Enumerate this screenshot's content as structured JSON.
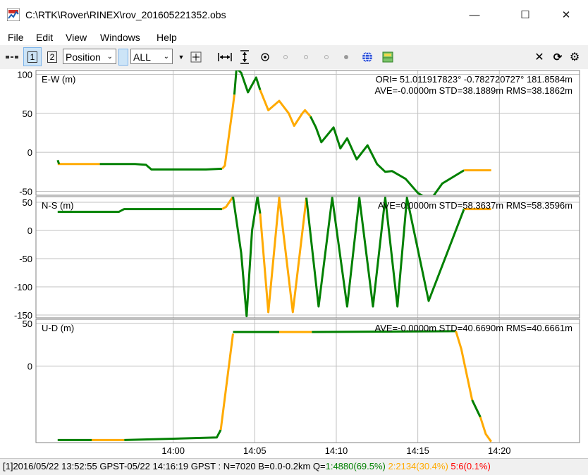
{
  "window": {
    "title": "C:\\RTK\\Rover\\RINEX\\rov_201605221352.obs",
    "minimize_glyph": "—",
    "maximize_glyph": "☐",
    "close_glyph": "✕"
  },
  "menu": [
    "File",
    "Edit",
    "View",
    "Windows",
    "Help"
  ],
  "toolbar": {
    "plot1_label": "1",
    "plot2_label": "2",
    "plot_type": "Position",
    "satellite_filter": "ALL",
    "icons": [
      "connect-icon",
      "fit-horizontal-icon",
      "fit-vertical-icon",
      "center-origin-icon",
      "show-track-icon",
      "globe-icon",
      "map-image-icon",
      "close-icon",
      "reload-icon",
      "options-icon"
    ]
  },
  "colors": {
    "fix": "#008000",
    "float": "#ffaa00",
    "single": "#ff0000",
    "grid": "#c0c0c0"
  },
  "chart_data": [
    {
      "type": "line",
      "title": "E-W (m)",
      "ylabel": "E-W (m)",
      "annotation_line1": "ORI= 51.011917823°  -0.782720727° 181.8584m",
      "annotation_line2": "AVE=-0.0000m STD=38.1889m RMS=38.1862m",
      "ylim": [
        -55,
        105
      ],
      "yticks": [
        100,
        50,
        0,
        -50
      ],
      "series": [
        {
          "quality": "float",
          "points": [
            [
              "13:52:55",
              -15
            ],
            [
              "13:55:30",
              -15
            ]
          ]
        },
        {
          "quality": "fix",
          "points": [
            [
              "13:52:55",
              -10
            ],
            [
              "13:53:00",
              -15
            ]
          ]
        },
        {
          "quality": "fix",
          "points": [
            [
              "13:55:30",
              -15
            ],
            [
              "13:57:40",
              -15
            ],
            [
              "13:58:20",
              -16
            ],
            [
              "13:58:40",
              -22
            ],
            [
              "14:00:30",
              -22
            ],
            [
              "14:02:00",
              -22
            ],
            [
              "14:03:00",
              -21
            ]
          ]
        },
        {
          "quality": "float",
          "points": [
            [
              "14:03:00",
              -21
            ],
            [
              "14:03:10",
              -17
            ],
            [
              "14:03:40",
              60
            ],
            [
              "14:03:45",
              74
            ]
          ]
        },
        {
          "quality": "fix",
          "points": [
            [
              "14:03:45",
              74
            ],
            [
              "14:03:53",
              108
            ],
            [
              "14:04:10",
              102
            ],
            [
              "14:04:35",
              77
            ],
            [
              "14:05:05",
              96
            ],
            [
              "14:05:20",
              80
            ]
          ]
        },
        {
          "quality": "float",
          "points": [
            [
              "14:05:20",
              80
            ],
            [
              "14:05:50",
              54
            ],
            [
              "14:06:30",
              66
            ],
            [
              "14:07:05",
              50
            ],
            [
              "14:07:25",
              34
            ],
            [
              "14:07:55",
              50
            ],
            [
              "14:08:05",
              54
            ],
            [
              "14:08:25",
              46
            ]
          ]
        },
        {
          "quality": "fix",
          "points": [
            [
              "14:08:25",
              46
            ],
            [
              "14:08:45",
              32
            ],
            [
              "14:09:05",
              13
            ],
            [
              "14:09:50",
              32
            ],
            [
              "14:10:15",
              5
            ],
            [
              "14:10:40",
              18
            ],
            [
              "14:11:15",
              -9
            ],
            [
              "14:11:55",
              9
            ],
            [
              "14:12:30",
              -15
            ],
            [
              "14:13:00",
              -25
            ],
            [
              "14:13:25",
              -24
            ],
            [
              "14:14:15",
              -34
            ],
            [
              "14:15:00",
              -52
            ],
            [
              "14:15:45",
              -62
            ],
            [
              "14:16:30",
              -40
            ],
            [
              "14:17:50",
              -23
            ]
          ]
        },
        {
          "quality": "float",
          "points": [
            [
              "14:17:50",
              -23
            ],
            [
              "14:19:30",
              -23
            ]
          ]
        }
      ]
    },
    {
      "type": "line",
      "title": "N-S (m)",
      "ylabel": "N-S (m)",
      "annotation_line1": "AVE=0.0000m STD=58.3637m RMS=58.3596m",
      "ylim": [
        -155,
        60
      ],
      "yticks": [
        50,
        0,
        -50,
        -100,
        -150
      ],
      "series": [
        {
          "quality": "fix",
          "points": [
            [
              "13:52:55",
              33
            ],
            [
              "13:56:40",
              33
            ],
            [
              "13:57:00",
              38
            ],
            [
              "14:03:00",
              38
            ]
          ]
        },
        {
          "quality": "float",
          "points": [
            [
              "14:03:00",
              38
            ],
            [
              "14:03:15",
              42
            ],
            [
              "14:03:40",
              60
            ]
          ]
        },
        {
          "quality": "fix",
          "points": [
            [
              "14:03:40",
              60
            ],
            [
              "14:04:10",
              -40
            ],
            [
              "14:04:30",
              -152
            ],
            [
              "14:04:50",
              0
            ],
            [
              "14:05:10",
              60
            ],
            [
              "14:05:20",
              30
            ]
          ]
        },
        {
          "quality": "float",
          "points": [
            [
              "14:05:20",
              30
            ],
            [
              "14:05:50",
              -145
            ],
            [
              "14:06:30",
              58
            ],
            [
              "14:07:20",
              -145
            ],
            [
              "14:08:10",
              58
            ]
          ]
        },
        {
          "quality": "fix",
          "points": [
            [
              "14:08:10",
              58
            ],
            [
              "14:08:55",
              -135
            ],
            [
              "14:09:45",
              58
            ],
            [
              "14:10:40",
              -135
            ],
            [
              "14:11:25",
              58
            ],
            [
              "14:12:15",
              -135
            ],
            [
              "14:13:00",
              58
            ],
            [
              "14:13:45",
              -135
            ],
            [
              "14:14:20",
              58
            ],
            [
              "14:15:40",
              -125
            ],
            [
              "14:17:50",
              38
            ]
          ]
        },
        {
          "quality": "float",
          "points": [
            [
              "14:17:50",
              38
            ],
            [
              "14:19:30",
              38
            ]
          ]
        }
      ]
    },
    {
      "type": "line",
      "title": "U-D (m)",
      "ylabel": "U-D (m)",
      "annotation_line1": "AVE=-0.0000m STD=40.6690m RMS=40.6661m",
      "ylim": [
        -90,
        55
      ],
      "yticks": [
        50,
        0
      ],
      "series": [
        {
          "quality": "fix",
          "points": [
            [
              "13:52:55",
              -87
            ],
            [
              "13:55:00",
              -87
            ]
          ]
        },
        {
          "quality": "float",
          "points": [
            [
              "13:55:00",
              -87
            ],
            [
              "13:57:00",
              -87
            ]
          ]
        },
        {
          "quality": "fix",
          "points": [
            [
              "13:57:00",
              -87
            ],
            [
              "14:02:40",
              -84
            ],
            [
              "14:02:55",
              -75
            ]
          ]
        },
        {
          "quality": "float",
          "points": [
            [
              "14:02:55",
              -75
            ],
            [
              "14:03:40",
              38
            ]
          ]
        },
        {
          "quality": "fix",
          "points": [
            [
              "14:03:40",
              40
            ],
            [
              "14:06:30",
              40
            ]
          ]
        },
        {
          "quality": "float",
          "points": [
            [
              "14:06:30",
              40
            ],
            [
              "14:08:30",
              40
            ]
          ]
        },
        {
          "quality": "fix",
          "points": [
            [
              "14:08:30",
              40
            ],
            [
              "14:17:20",
              41
            ]
          ]
        },
        {
          "quality": "float",
          "points": [
            [
              "14:17:20",
              41
            ],
            [
              "14:17:40",
              20
            ],
            [
              "14:18:20",
              -40
            ]
          ]
        },
        {
          "quality": "fix",
          "points": [
            [
              "14:18:20",
              -40
            ],
            [
              "14:18:50",
              -60
            ]
          ]
        },
        {
          "quality": "float",
          "points": [
            [
              "14:18:50",
              -60
            ],
            [
              "14:19:10",
              -80
            ],
            [
              "14:19:30",
              -89
            ]
          ]
        }
      ]
    }
  ],
  "x_axis": {
    "range": [
      "13:51:35",
      "14:24:55"
    ],
    "ticks": [
      "14:00",
      "14:05",
      "14:10",
      "14:15",
      "14:20"
    ]
  },
  "status": {
    "prefix": "[1]2016/05/22 13:52:55 GPST-05/22 14:16:19 GPST : N=7020 B=0.0-0.2km Q=",
    "q1": "1:4880(69.5%)",
    "q2": "2:2134(30.4%)",
    "q5": "5:6(0.1%)"
  }
}
